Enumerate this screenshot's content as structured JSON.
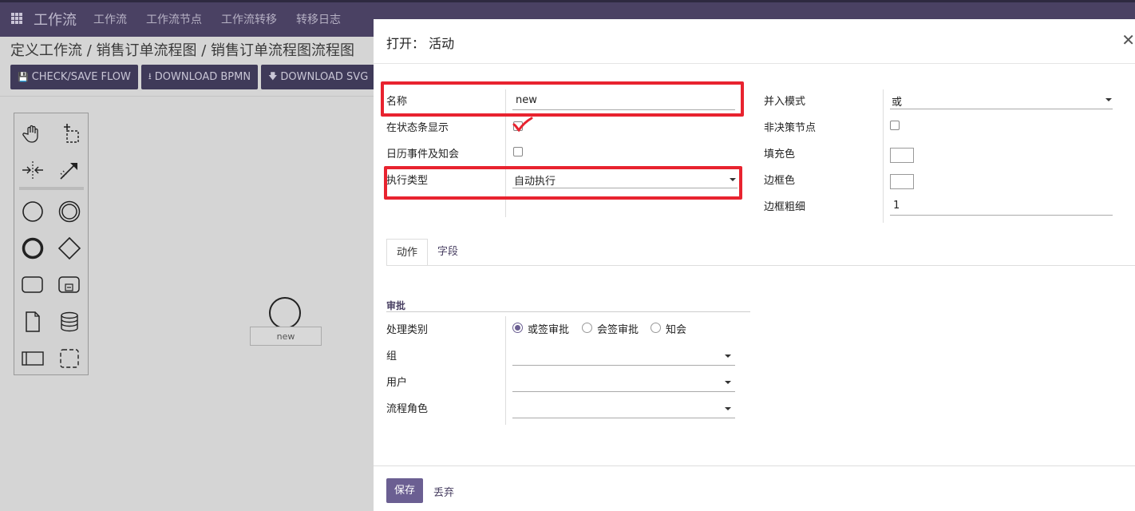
{
  "app": {
    "brand": "工作流",
    "nav": [
      "工作流",
      "工作流节点",
      "工作流转移",
      "转移日志"
    ]
  },
  "breadcrumb": "定义工作流 / 销售订单流程图 / 销售订单流程图流程图",
  "toolbar": {
    "check_save": "CHECK/SAVE FLOW",
    "download_bpmn": "DOWNLOAD BPMN",
    "download_svg": "DOWNLOAD SVG"
  },
  "palette": {
    "items": [
      "hand-tool",
      "lasso-tool",
      "space-tool",
      "connect-tool",
      "start-event",
      "intermediate-event",
      "end-event",
      "gateway",
      "task",
      "subprocess",
      "data-object",
      "data-store",
      "pool",
      "group"
    ]
  },
  "canvas": {
    "node_label": "new"
  },
  "dialog": {
    "title": "打开：  活动",
    "left": {
      "name_label": "名称",
      "name_value": "new",
      "show_in_statusbar_label": "在状态条显示",
      "show_in_statusbar_checked": true,
      "calendar_label": "日历事件及知会",
      "calendar_checked": false,
      "exec_type_label": "执行类型",
      "exec_type_value": "自动执行"
    },
    "right": {
      "join_mode_label": "并入模式",
      "join_mode_value": "或",
      "non_decision_label": "非决策节点",
      "non_decision_checked": false,
      "fill_color_label": "填充色",
      "border_color_label": "边框色",
      "border_width_label": "边框粗细",
      "border_width_value": "1"
    },
    "tabs": [
      "动作",
      "字段"
    ],
    "active_tab": "动作",
    "approval": {
      "section_title": "审批",
      "type_label": "处理类别",
      "options": [
        "或签审批",
        "会签审批",
        "知会"
      ],
      "selected": "或签审批",
      "group_label": "组",
      "user_label": "用户",
      "role_label": "流程角色"
    },
    "footer": {
      "save": "保存",
      "discard": "丢弃"
    }
  },
  "colors": {
    "topbar": "#4a4163",
    "primary": "#6b5f92",
    "annotation_red": "#e8232f"
  }
}
